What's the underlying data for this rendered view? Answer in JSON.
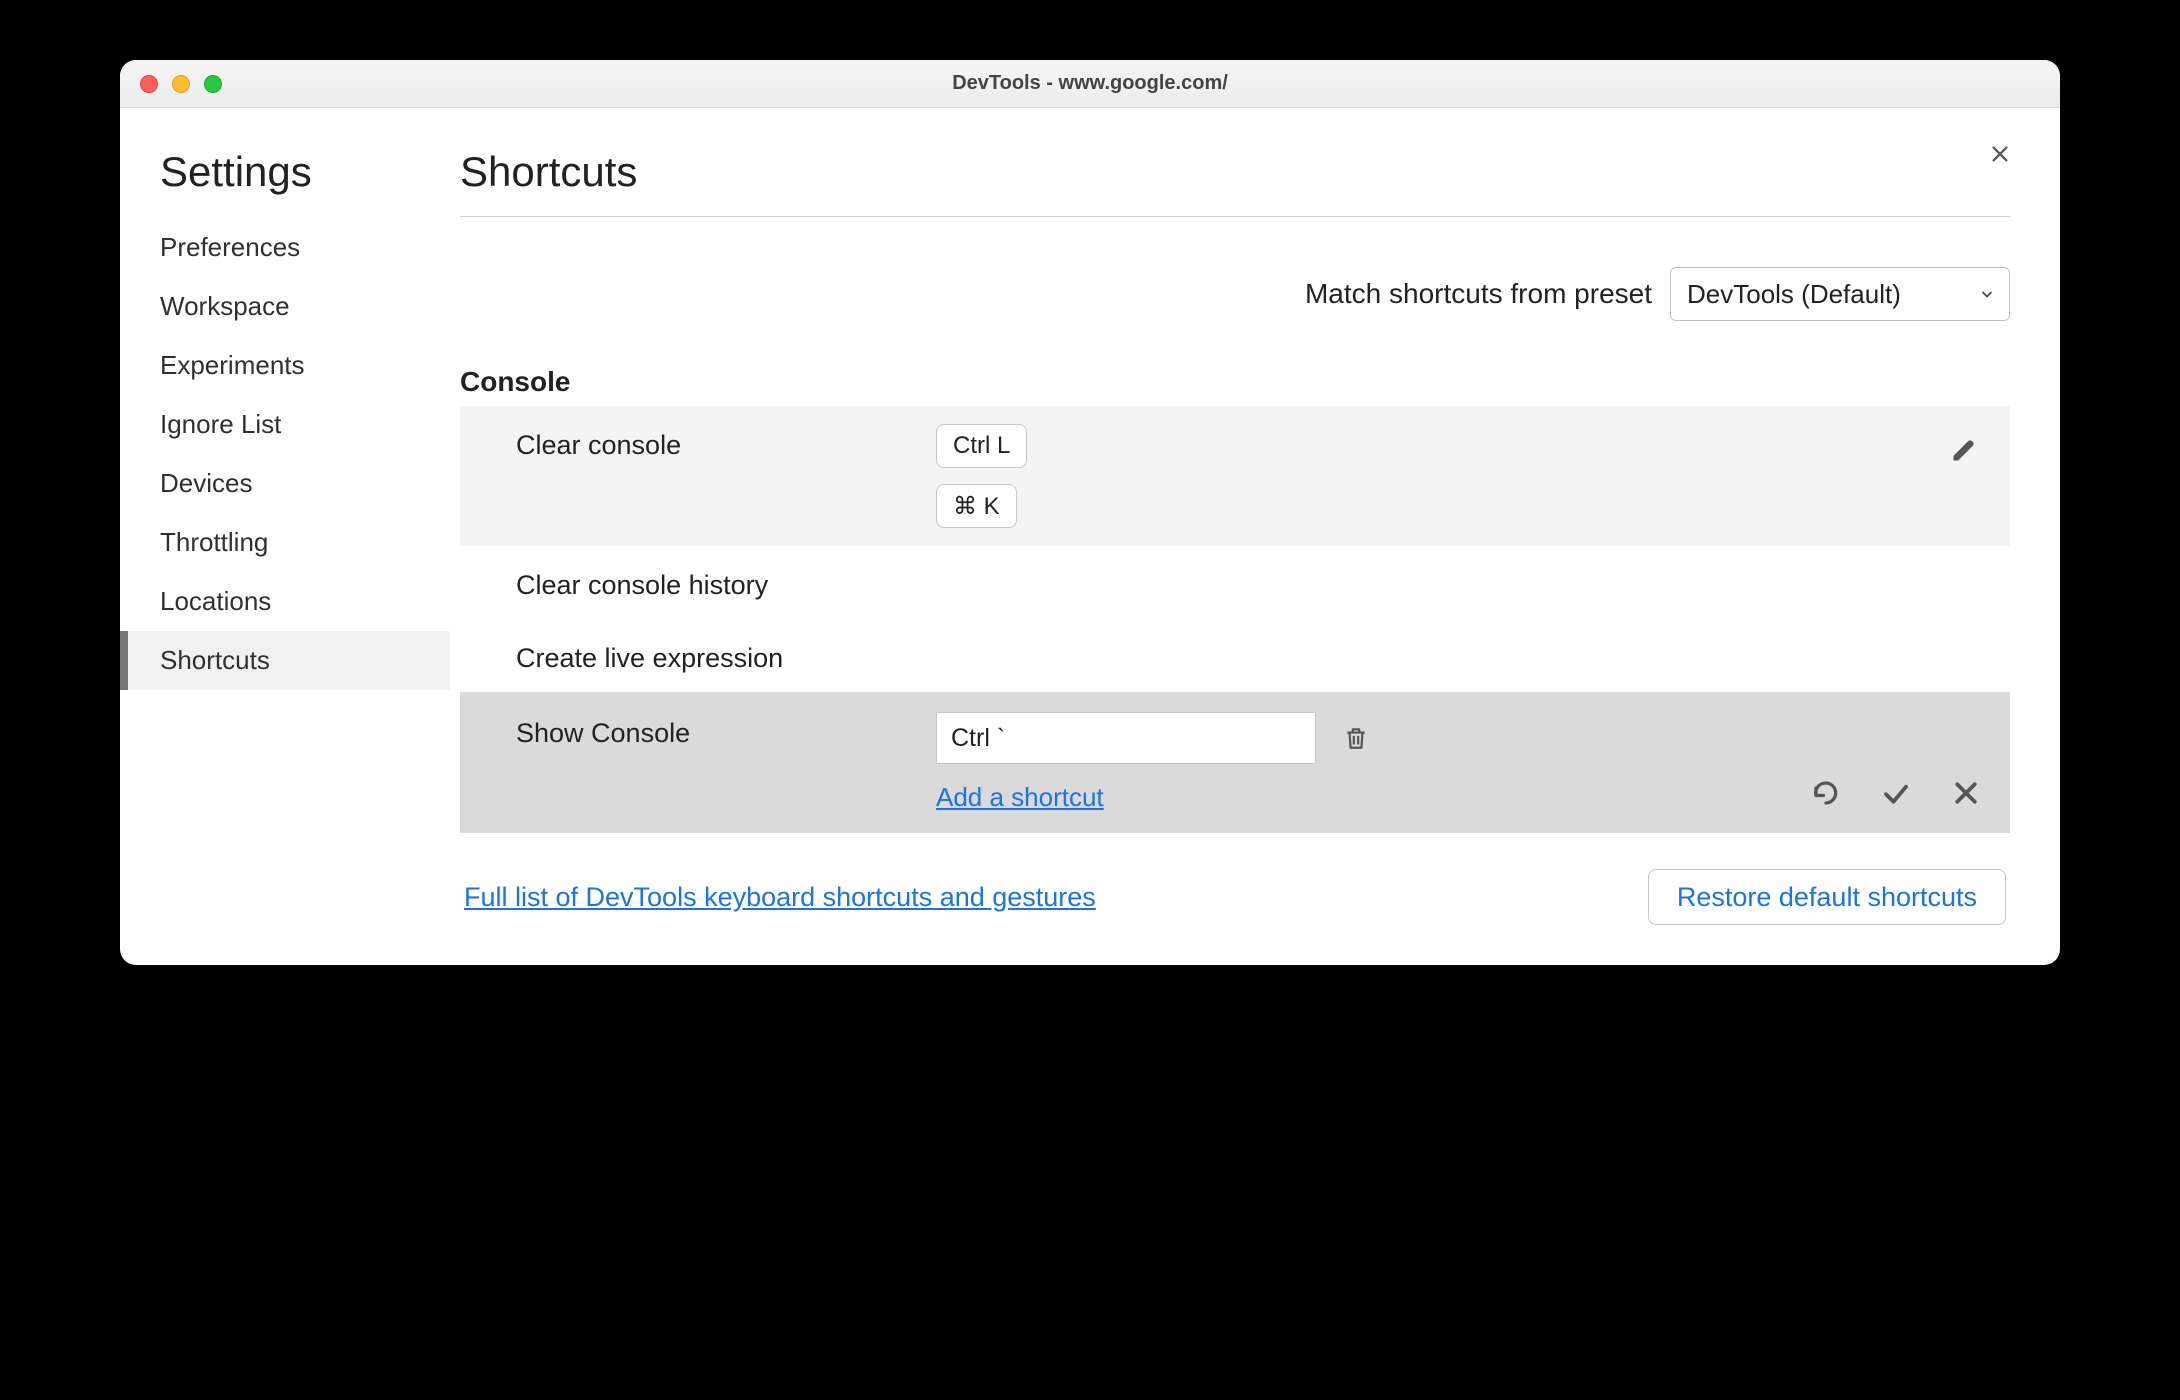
{
  "window": {
    "title": "DevTools - www.google.com/"
  },
  "sidebar": {
    "title": "Settings",
    "items": [
      {
        "label": "Preferences"
      },
      {
        "label": "Workspace"
      },
      {
        "label": "Experiments"
      },
      {
        "label": "Ignore List"
      },
      {
        "label": "Devices"
      },
      {
        "label": "Throttling"
      },
      {
        "label": "Locations"
      },
      {
        "label": "Shortcuts"
      }
    ],
    "active_index": 7
  },
  "main": {
    "title": "Shortcuts",
    "preset_label": "Match shortcuts from preset",
    "preset_value": "DevTools (Default)",
    "section": "Console",
    "rows": {
      "clear_console": {
        "name": "Clear console",
        "keys": [
          "Ctrl L",
          "⌘ K"
        ]
      },
      "clear_console_history": {
        "name": "Clear console history"
      },
      "create_live_expression": {
        "name": "Create live expression"
      },
      "show_console": {
        "name": "Show Console",
        "input_value": "Ctrl `",
        "add_label": "Add a shortcut"
      }
    },
    "footer": {
      "link": "Full list of DevTools keyboard shortcuts and gestures",
      "restore": "Restore default shortcuts"
    }
  }
}
